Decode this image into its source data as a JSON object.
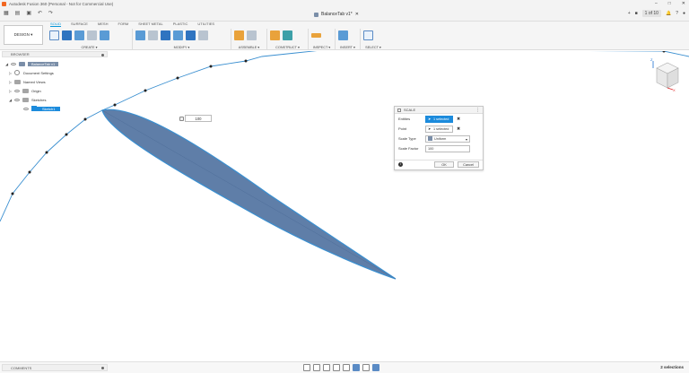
{
  "window": {
    "title": "Autodesk Fusion 360 (Personal - Not for Commercial Use)",
    "minimize": "–",
    "maximize": "□",
    "close": "✕"
  },
  "document": {
    "tab_title": "BalanceTab v1*",
    "pager": "1 of 10"
  },
  "ribbon": {
    "workspace": "DESIGN ▾",
    "tabs": [
      "SOLID",
      "SURFACE",
      "MESH",
      "FORM",
      "SHEET METAL",
      "PLASTIC",
      "UTILITIES"
    ],
    "groups": {
      "create": "CREATE ▾",
      "modify": "MODIFY ▾",
      "assemble": "ASSEMBLE ▾",
      "construct": "CONSTRUCT ▾",
      "inspect": "INSPECT ▾",
      "insert": "INSERT ▾",
      "select": "SELECT ▾"
    }
  },
  "browser": {
    "title": "BROWSER",
    "items": {
      "root": "BalanceTab v1",
      "doc_settings": "Document Settings",
      "named_views": "Named Views",
      "origin": "Origin",
      "sketches": "Sketches",
      "sketch1": "Sketch1"
    }
  },
  "canvas": {
    "dimension_value": "100"
  },
  "scale_dialog": {
    "title": "SCALE",
    "rows": {
      "entities": {
        "label": "Entities",
        "value": "1 selected"
      },
      "point": {
        "label": "Point",
        "value": "1 selected"
      },
      "scale_type": {
        "label": "Scale Type",
        "value": "Uniform"
      },
      "scale_factor": {
        "label": "Scale Factor",
        "value": "100"
      }
    },
    "ok": "OK",
    "cancel": "Cancel"
  },
  "bottom": {
    "comments": "COMMENTS",
    "selections": "2 selections"
  },
  "colors": {
    "accent": "#0696d7",
    "selection": "#1c8bdc",
    "airfoil_fill": "#5f7ea8",
    "sketch_line": "#3a8fd0"
  }
}
